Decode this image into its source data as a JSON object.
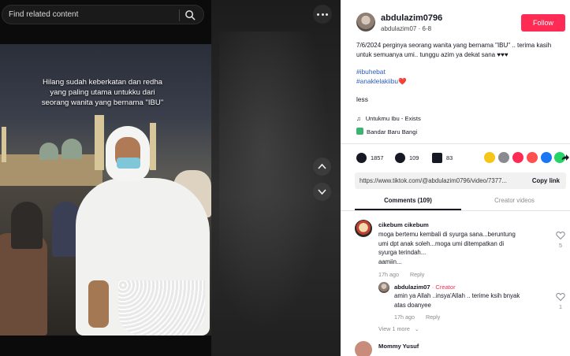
{
  "search": {
    "placeholder": "Find related content"
  },
  "video": {
    "caption_lines": [
      "Hilang sudah keberkatan dan redha",
      "yang paling utama untukku dari",
      "seorang wanita yang bernama \"IBU\""
    ]
  },
  "author": {
    "username": "abdulazim0796",
    "handle": "abdulazim07",
    "date": "6-8",
    "follow_label": "Follow"
  },
  "description": {
    "text": "7/6/2024 perginya seorang wanita yang bernama \"IBU\" .. terima kasih untuk semuanya umi.. tunggu azim ya dekat sana ♥♥♥",
    "tags": [
      "#ibuhebat",
      "#anaklelakiibu❤️"
    ],
    "less_label": "less"
  },
  "music": {
    "icon": "music-note-icon",
    "title": "Untukmu Ibu - Exists"
  },
  "location": {
    "name": "Bandar Baru Bangi"
  },
  "stats": {
    "likes": "1857",
    "comments": "109",
    "saves": "83"
  },
  "share_icons": [
    {
      "name": "share-coin-icon",
      "color": "#f5c518"
    },
    {
      "name": "embed-icon",
      "color": "#8a8b91"
    },
    {
      "name": "send-icon",
      "color": "#fe2c55"
    },
    {
      "name": "telegram-icon",
      "color": "#ff4f4f"
    },
    {
      "name": "facebook-icon",
      "color": "#1877f2"
    },
    {
      "name": "whatsapp-icon",
      "color": "#25d366"
    },
    {
      "name": "share-arrow-icon",
      "color": "#161823"
    }
  ],
  "link": {
    "url": "https://www.tiktok.com/@abdulazim0796/video/7377...",
    "copy_label": "Copy link"
  },
  "tabs": {
    "comments": "Comments (109)",
    "creator_videos": "Creator videos"
  },
  "comments": [
    {
      "author": "cikebum cikebum",
      "text_lines": [
        "moga bertemu kembali di syurga sana...beruntung",
        "umi dpt anak soleh...moga umi ditempatkan di",
        "syurga terindah...",
        "aamiin..."
      ],
      "time": "17h ago",
      "reply_label": "Reply",
      "likes": "5"
    },
    {
      "author": "abdulazim07",
      "badge": "· Creator",
      "text_lines": [
        "amin ya Allah ..insya'Allah .. terime ksih bnyak",
        "atas doanyee"
      ],
      "time": "17h ago",
      "reply_label": "Reply",
      "likes": "1"
    }
  ],
  "view_more": "View 1 more",
  "next_commenter": "Mommy Yusuf",
  "colors": {
    "accent": "#fe2c55",
    "hashtag": "#2b5db9",
    "creator": "#fe2c55"
  }
}
